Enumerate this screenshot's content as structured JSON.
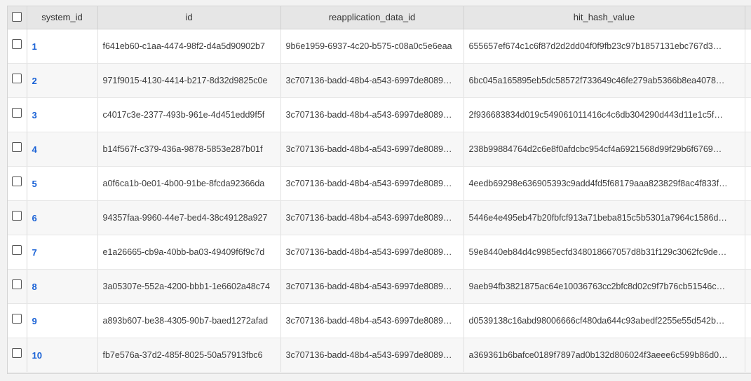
{
  "columns": {
    "system_id": "system_id",
    "id": "id",
    "reapplication_data_id": "reapplication_data_id",
    "hit_hash_value": "hit_hash_value"
  },
  "rows": [
    {
      "system_id": "1",
      "id": "f641eb60-c1aa-4474-98f2-d4a5d90902b7",
      "reapplication_data_id": "9b6e1959-6937-4c20-b575-c08a0c5e6eaa",
      "hit_hash_value": "655657ef674c1c6f87d2d2dd04f0f9fb23c97b1857131ebc767d3…"
    },
    {
      "system_id": "2",
      "id": "971f9015-4130-4414-b217-8d32d9825c0e",
      "reapplication_data_id": "3c707136-badd-48b4-a543-6997de8089…",
      "hit_hash_value": "6bc045a165895eb5dc58572f733649c46fe279ab5366b8ea4078…"
    },
    {
      "system_id": "3",
      "id": "c4017c3e-2377-493b-961e-4d451edd9f5f",
      "reapplication_data_id": "3c707136-badd-48b4-a543-6997de8089…",
      "hit_hash_value": "2f936683834d019c549061011416c4c6db304290d443d11e1c5f…"
    },
    {
      "system_id": "4",
      "id": "b14f567f-c379-436a-9878-5853e287b01f",
      "reapplication_data_id": "3c707136-badd-48b4-a543-6997de8089…",
      "hit_hash_value": "238b99884764d2c6e8f0afdcbc954cf4a6921568d99f29b6f6769…"
    },
    {
      "system_id": "5",
      "id": "a0f6ca1b-0e01-4b00-91be-8fcda92366da",
      "reapplication_data_id": "3c707136-badd-48b4-a543-6997de8089…",
      "hit_hash_value": "4eedb69298e636905393c9add4fd5f68179aaa823829f8ac4f833f…"
    },
    {
      "system_id": "6",
      "id": "94357faa-9960-44e7-bed4-38c49128a927",
      "reapplication_data_id": "3c707136-badd-48b4-a543-6997de8089…",
      "hit_hash_value": "5446e4e495eb47b20fbfcf913a71beba815c5b5301a7964c1586d…"
    },
    {
      "system_id": "7",
      "id": "e1a26665-cb9a-40bb-ba03-49409f6f9c7d",
      "reapplication_data_id": "3c707136-badd-48b4-a543-6997de8089…",
      "hit_hash_value": "59e8440eb84d4c9985ecfd348018667057d8b31f129c3062fc9de…"
    },
    {
      "system_id": "8",
      "id": "3a05307e-552a-4200-bbb1-1e6602a48c74",
      "reapplication_data_id": "3c707136-badd-48b4-a543-6997de8089…",
      "hit_hash_value": "9aeb94fb3821875ac64e10036763cc2bfc8d02c9f7b76cb51546c…"
    },
    {
      "system_id": "9",
      "id": "a893b607-be38-4305-90b7-baed1272afad",
      "reapplication_data_id": "3c707136-badd-48b4-a543-6997de8089…",
      "hit_hash_value": "d0539138c16abd98006666cf480da644c93abedf2255e55d542b…"
    },
    {
      "system_id": "10",
      "id": "fb7e576a-37d2-485f-8025-50a57913fbc6",
      "reapplication_data_id": "3c707136-badd-48b4-a543-6997de8089…",
      "hit_hash_value": "a369361b6bafce0189f7897ad0b132d806024f3aeee6c599b86d0…"
    }
  ],
  "colors": {
    "link": "#1a62d6",
    "header_bg": "#e6e6e6",
    "page_bg": "#f2f2f2"
  }
}
